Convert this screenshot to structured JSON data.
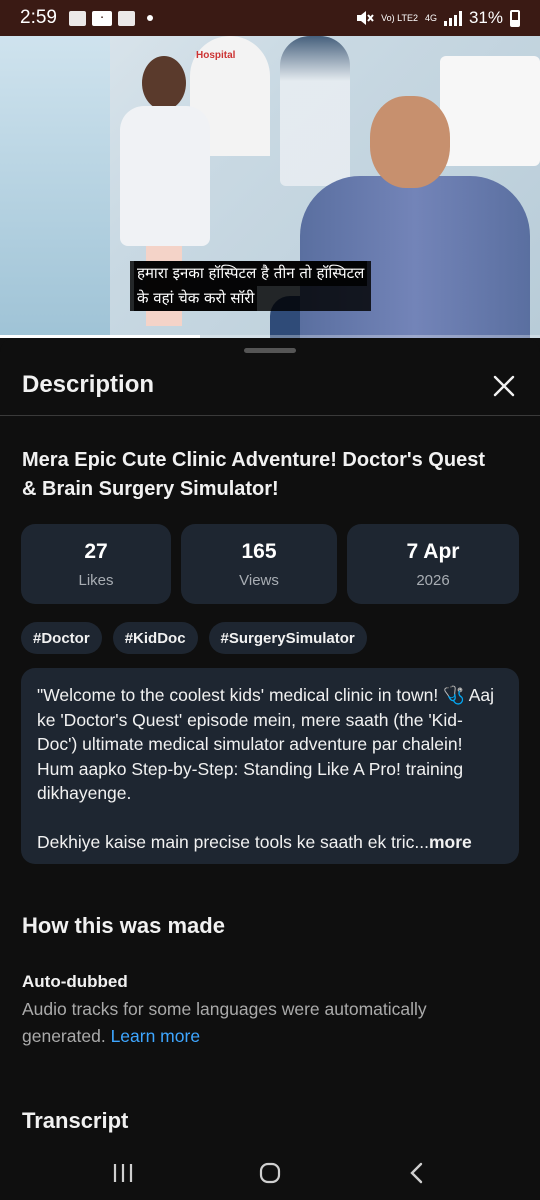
{
  "status_bar": {
    "time": "2:59",
    "network_small": "Vo) LTE2",
    "network_type": "4G",
    "battery_percent": "31%"
  },
  "video": {
    "subtitle_line1": "हमारा इनका हॉस्पिटल है तीन तो हॉस्पिटल",
    "subtitle_line2": "के वहां चेक करो सॉरी",
    "poster_sign": "Hospital",
    "progress_fraction": 0.37
  },
  "sheet": {
    "header_title": "Description",
    "video_title": "Mera Epic Cute Clinic Adventure! Doctor's Quest & Brain Surgery Simulator!",
    "stats": [
      {
        "value": "27",
        "label": "Likes"
      },
      {
        "value": "165",
        "label": "Views"
      },
      {
        "value": "7 Apr",
        "label": "2026"
      }
    ],
    "hashtags": [
      "#Doctor",
      "#KidDoc",
      "#SurgerySimulator"
    ],
    "description_para1": "\"Welcome to the coolest kids' medical clinic in town! 🩺 Aaj ke 'Doctor's Quest' episode mein, mere saath (the 'Kid-Doc') ultimate medical simulator adventure par chalein! Hum aapko Step-by-Step: Standing Like A Pro! training dikhayenge.",
    "description_para2": "Dekhiye kaise main precise tools ke saath ek tric...",
    "more_label": "more",
    "how_made_heading": "How this was made",
    "auto_dubbed_title": "Auto-dubbed",
    "auto_dubbed_text": "Audio tracks for some languages were automatically generated.",
    "learn_more_label": "Learn more",
    "transcript_heading": "Transcript"
  },
  "colors": {
    "background": "#0f0f0f",
    "card": "#1e2631",
    "link": "#3ea6ff",
    "muted_text": "#aaaaaa",
    "status_bar": "#3a1a14"
  },
  "icons": {
    "close": "close-icon",
    "nav_recents": "recents-icon",
    "nav_home": "home-icon",
    "nav_back": "back-icon"
  }
}
